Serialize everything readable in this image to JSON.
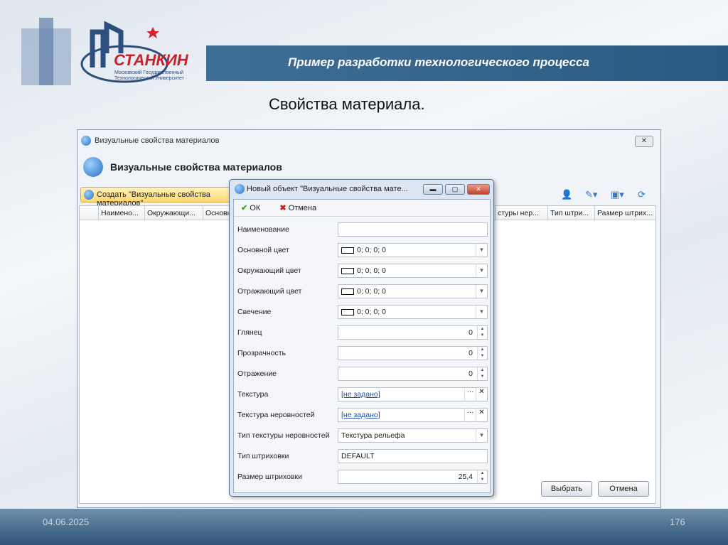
{
  "slide": {
    "title": "Пример разработки технологического процесса",
    "subtitle": "Свойства материала.",
    "date": "04.06.2025",
    "page": "176",
    "logo_text": "СТАНКИН",
    "logo_sub1": "Московский Государственный",
    "logo_sub2": "Технологический Университет"
  },
  "window": {
    "title": "Визуальные свойства материалов",
    "heading": "Визуальные свойства материалов",
    "create_button": "Создать \"Визуальные свойства материалов\"",
    "columns": [
      "Наимено...",
      "Окружающи...",
      "Основн...",
      "стуры нер...",
      "Тип штри...",
      "Размер штрих..."
    ],
    "select_button": "Выбрать",
    "cancel_button": "Отмена",
    "close": "✕"
  },
  "dialog": {
    "title": "Новый объект \"Визуальные свойства мате...",
    "ok": "ОК",
    "cancel": "Отмена",
    "fields": [
      {
        "label": "Наименование",
        "value": ""
      },
      {
        "label": "Основной цвет",
        "value": "0; 0; 0; 0"
      },
      {
        "label": "Окружающий цвет",
        "value": "0; 0; 0; 0"
      },
      {
        "label": "Отражающий цвет",
        "value": "0; 0; 0; 0"
      },
      {
        "label": "Свечение",
        "value": "0; 0; 0; 0"
      },
      {
        "label": "Глянец",
        "value": "0"
      },
      {
        "label": "Прозрачность",
        "value": "0"
      },
      {
        "label": "Отражение",
        "value": "0"
      },
      {
        "label": "Текстура",
        "value": "[не задано]"
      },
      {
        "label": "Текстура неровностей",
        "value": "[не задано]"
      },
      {
        "label": "Тип текстуры неровностей",
        "value": "Текстура рельефа"
      },
      {
        "label": "Тип штриховки",
        "value": "DEFAULT"
      },
      {
        "label": "Размер штриховки",
        "value": "25,4"
      }
    ]
  }
}
